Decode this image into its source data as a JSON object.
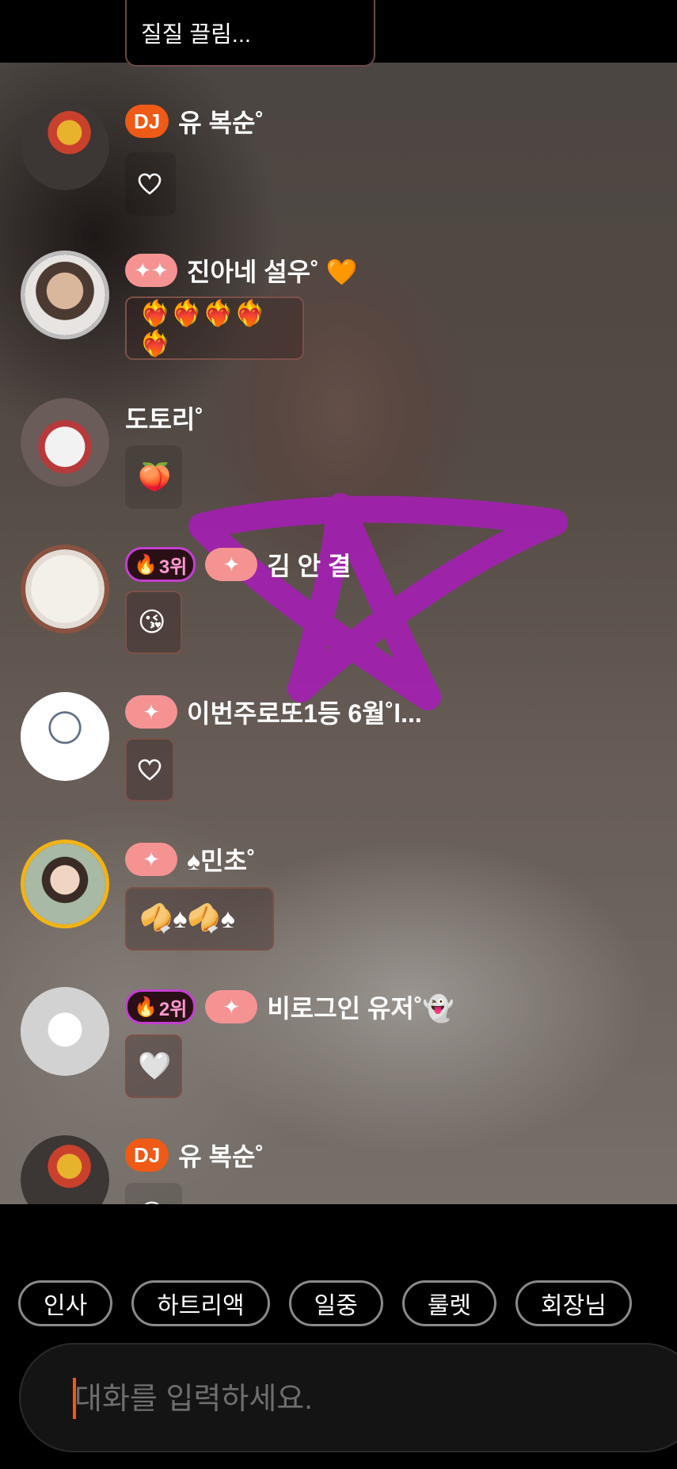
{
  "top_bubble_text": "질질 끌림...",
  "messages": [
    {
      "badge_dj": "DJ",
      "name": "유 복순˚",
      "content": "heart-outline"
    },
    {
      "name": "진아네 설우˚ 🧡",
      "content": "❤️‍🔥❤️‍🔥❤️‍🔥❤️‍🔥❤️‍🔥"
    },
    {
      "name": "도토리˚",
      "content": "🍑"
    },
    {
      "rank": "3위",
      "name": "김 안 결",
      "content": "😘"
    },
    {
      "name": "이번주로또1등 6월˚l...",
      "content": "heart-outline"
    },
    {
      "name": "♠민초˚",
      "content": "🥠♠🥠♠"
    },
    {
      "rank": "2위",
      "name": "비로그인 유저˚👻",
      "content": "🤍"
    },
    {
      "badge_dj": "DJ",
      "name": "유 복순˚",
      "content": "😍"
    }
  ],
  "quick_replies": [
    "인사",
    "하트리액",
    "일중",
    "룰렛",
    "회장님"
  ],
  "input": {
    "placeholder": "대화를 입력하세요.",
    "value": ""
  },
  "colors": {
    "dj_badge": "#ef5a16",
    "spark_badge": "#f59393",
    "rank_border": "#c33fd0",
    "doodle": "#a41fb3"
  },
  "icons": [
    "heart-outline-icon",
    "sparkle-icon",
    "fire-icon",
    "ghost-avatar"
  ]
}
